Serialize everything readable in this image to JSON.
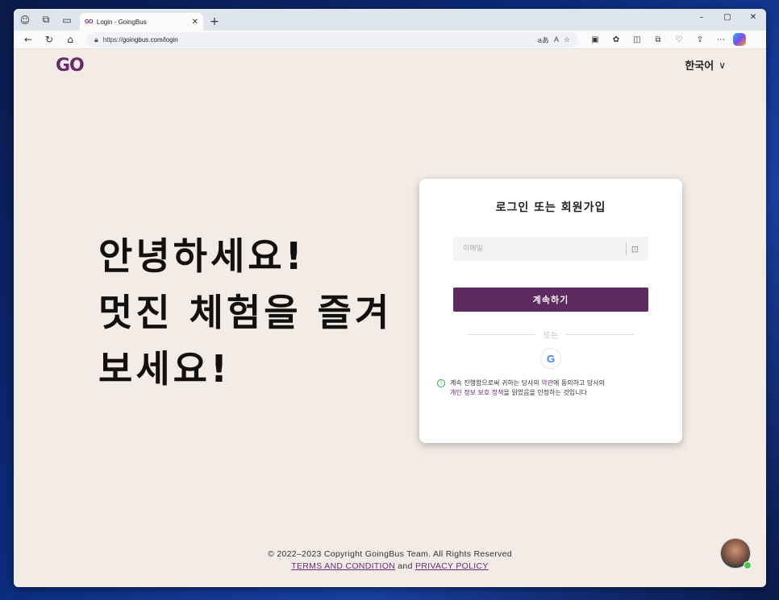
{
  "browser": {
    "tab_title": "Login - GoingBus",
    "tab_favicon": "GO",
    "url_prefix": "https://",
    "url_host": "goingbus.com/login",
    "reading_icon_label": "aあ",
    "read_aloud_label": "A",
    "controls": {
      "minimize": "–",
      "maximize": "▢",
      "close": "✕"
    }
  },
  "header": {
    "logo": "GO",
    "language": "한국어",
    "language_chevron": "∨"
  },
  "hero": {
    "line1": "안녕하세요!",
    "line2": "멋진 체험을 즐겨",
    "line3": "보세요!"
  },
  "login_card": {
    "title": "로그인 또는 회원가입",
    "email_placeholder": "이메일",
    "continue_label": "계속하기",
    "or_label": "또는",
    "google_label": "G",
    "terms_part1": "계속 진행함으로써 귀하는 당사의 ",
    "terms_link1": "약관",
    "terms_part2": "에 동의하고 당사의",
    "terms_link2": "개인 정보 보호 정책",
    "terms_part3": "을 읽었음을 인정하는 것입니다"
  },
  "footer": {
    "copyright": "© 2022–2023 Copyright GoingBus Team. All Rights Reserved",
    "terms_link": "TERMS AND CONDITION",
    "and": "and",
    "privacy_link": "PRIVACY POLICY"
  },
  "colors": {
    "brand": "#6a2a6e",
    "button": "#5e2a62",
    "page_bg": "#f3ebe5"
  }
}
